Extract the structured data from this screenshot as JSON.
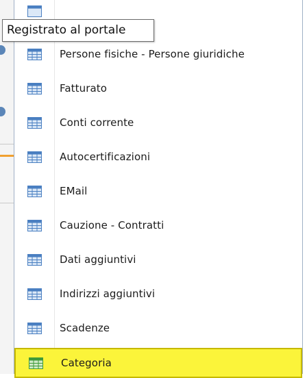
{
  "tooltip": {
    "text": "Registrato al portale"
  },
  "menu": {
    "items": [
      {
        "label": "Persone fisiche - Persone giuridiche",
        "icon": "table-icon",
        "selected": false
      },
      {
        "label": "Fatturato",
        "icon": "table-icon",
        "selected": false
      },
      {
        "label": "Conti corrente",
        "icon": "table-icon",
        "selected": false
      },
      {
        "label": "Autocertificazioni",
        "icon": "table-icon",
        "selected": false
      },
      {
        "label": "EMail",
        "icon": "table-icon",
        "selected": false
      },
      {
        "label": "Cauzione - Contratti",
        "icon": "table-icon",
        "selected": false
      },
      {
        "label": "Dati aggiuntivi",
        "icon": "table-icon",
        "selected": false
      },
      {
        "label": "Indirizzi aggiuntivi",
        "icon": "table-icon",
        "selected": false
      },
      {
        "label": "Scadenze",
        "icon": "table-icon",
        "selected": false
      },
      {
        "label": "Categoria",
        "icon": "table-icon",
        "selected": true
      }
    ]
  },
  "colors": {
    "highlight": "#fbf43a",
    "highlight_border": "#c6b800",
    "icon_blue": "#4a7fc1",
    "icon_green": "#3f9a3a"
  }
}
